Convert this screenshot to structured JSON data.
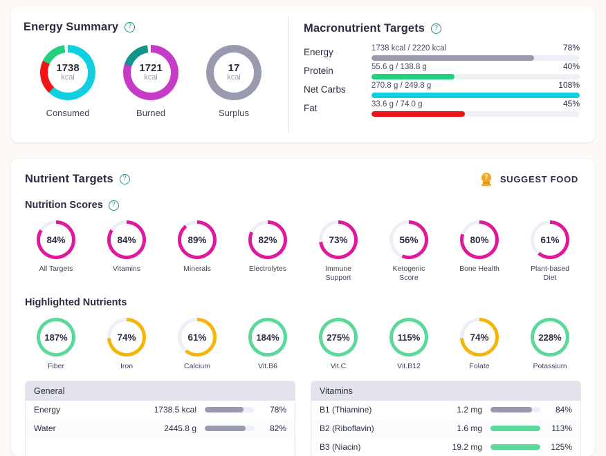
{
  "energy_summary": {
    "title": "Energy Summary",
    "help_icon": "help-circle-icon",
    "donuts": [
      {
        "label": "Consumed",
        "value": "1738",
        "unit": "kcal",
        "segments": [
          {
            "name": "net-carbs",
            "color": "#0fcfe0",
            "pct": 62
          },
          {
            "name": "fat",
            "color": "#f01414",
            "pct": 20
          },
          {
            "name": "protein",
            "color": "#23d07f",
            "pct": 16
          },
          {
            "name": "gap",
            "color": "#ffffff",
            "pct": 2
          }
        ]
      },
      {
        "label": "Burned",
        "value": "1721",
        "unit": "kcal",
        "segments": [
          {
            "name": "active",
            "color": "#c63bc6",
            "pct": 80
          },
          {
            "name": "rest",
            "color": "#12938c",
            "pct": 18
          },
          {
            "name": "gap",
            "color": "#ffffff",
            "pct": 2
          }
        ]
      },
      {
        "label": "Surplus",
        "value": "17",
        "unit": "kcal",
        "segments": [
          {
            "name": "surplus",
            "color": "#9a9aaf",
            "pct": 100
          }
        ]
      }
    ]
  },
  "macronutrient_targets": {
    "title": "Macronutrient Targets",
    "help_icon": "help-circle-icon",
    "rows": [
      {
        "name": "Energy",
        "detail": "1738 kcal / 2220 kcal",
        "pct_label": "78%",
        "pct": 78,
        "color": "#9a9aaf"
      },
      {
        "name": "Protein",
        "detail": "55.6 g / 138.8 g",
        "pct_label": "40%",
        "pct": 40,
        "color": "#23d07f"
      },
      {
        "name": "Net Carbs",
        "detail": "270.8 g / 249.8 g",
        "pct_label": "108%",
        "pct": 100,
        "color": "#0fcfe0"
      },
      {
        "name": "Fat",
        "detail": "33.6 g / 74.0 g",
        "pct_label": "45%",
        "pct": 45,
        "color": "#f01414"
      }
    ]
  },
  "nutrient_targets": {
    "title": "Nutrient Targets",
    "help_icon": "help-circle-icon",
    "suggest_food": {
      "label": "SUGGEST FOOD",
      "icon": "lightbulb-icon",
      "icon_glyph": "?"
    },
    "nutrition_scores": {
      "title": "Nutrition Scores",
      "help_icon": "help-circle-icon",
      "ring_color": "#e0189b",
      "track_color": "#eeeef7",
      "items": [
        {
          "label": "All Targets",
          "pct_label": "84%",
          "pct": 84
        },
        {
          "label": "Vitamins",
          "pct_label": "84%",
          "pct": 84
        },
        {
          "label": "Minerals",
          "pct_label": "89%",
          "pct": 89
        },
        {
          "label": "Electrolytes",
          "pct_label": "82%",
          "pct": 82
        },
        {
          "label": "Immune Support",
          "pct_label": "73%",
          "pct": 73
        },
        {
          "label": "Ketogenic Score",
          "pct_label": "56%",
          "pct": 56
        },
        {
          "label": "Bone Health",
          "pct_label": "80%",
          "pct": 80
        },
        {
          "label": "Plant-based Diet",
          "pct_label": "61%",
          "pct": 61
        }
      ]
    },
    "highlighted_nutrients": {
      "title": "Highlighted Nutrients",
      "color_complete": "#5bd99a",
      "color_partial": "#f5b409",
      "track_color": "#eeeef7",
      "items": [
        {
          "label": "Fiber",
          "pct_label": "187%",
          "pct": 100
        },
        {
          "label": "Iron",
          "pct_label": "74%",
          "pct": 74
        },
        {
          "label": "Calcium",
          "pct_label": "61%",
          "pct": 61
        },
        {
          "label": "Vit.B6",
          "pct_label": "184%",
          "pct": 100
        },
        {
          "label": "Vit.C",
          "pct_label": "275%",
          "pct": 100
        },
        {
          "label": "Vit.B12",
          "pct_label": "115%",
          "pct": 100
        },
        {
          "label": "Folate",
          "pct_label": "74%",
          "pct": 74
        },
        {
          "label": "Potassium",
          "pct_label": "228%",
          "pct": 100
        }
      ]
    },
    "tables": [
      {
        "header": "General",
        "rows": [
          {
            "name": "Energy",
            "value": "1738.5 kcal",
            "pct_label": "78%",
            "pct": 78,
            "color": "#9a9aaf"
          },
          {
            "name": "Water",
            "value": "2445.8 g",
            "pct_label": "82%",
            "pct": 82,
            "color": "#9a9aaf"
          }
        ]
      },
      {
        "header": "Vitamins",
        "rows": [
          {
            "name": "B1 (Thiamine)",
            "value": "1.2 mg",
            "pct_label": "84%",
            "pct": 84,
            "color": "#9a9aaf"
          },
          {
            "name": "B2 (Riboflavin)",
            "value": "1.6 mg",
            "pct_label": "113%",
            "pct": 100,
            "color": "#5bd99a"
          },
          {
            "name": "B3 (Niacin)",
            "value": "19.2 mg",
            "pct_label": "125%",
            "pct": 100,
            "color": "#5bd99a"
          }
        ]
      }
    ]
  }
}
